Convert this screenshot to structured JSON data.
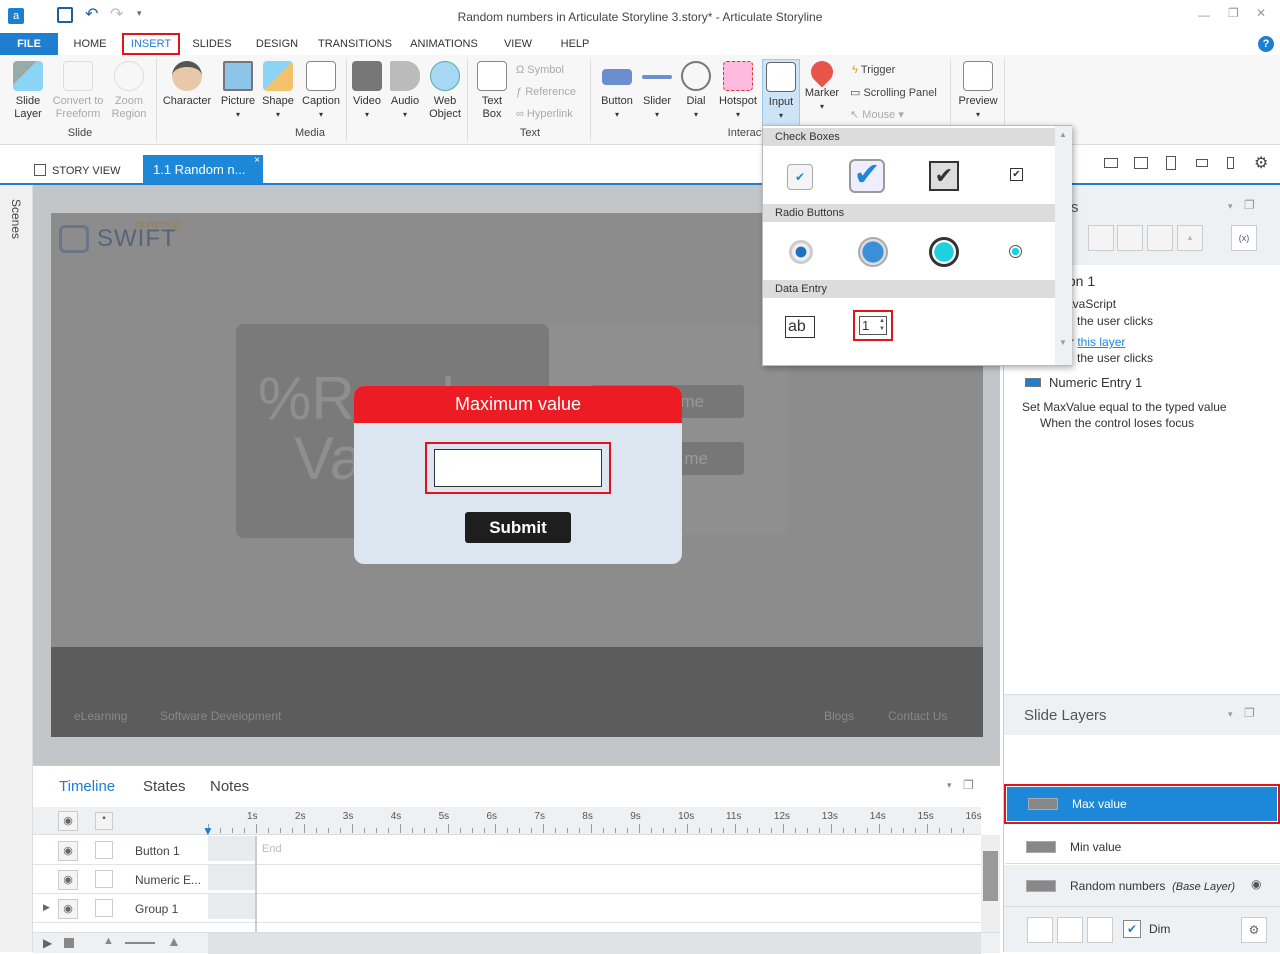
{
  "app": {
    "title": "Random numbers in Articulate Storyline 3.story* -  Articulate Storyline"
  },
  "menu_tabs": [
    "FILE",
    "HOME",
    "INSERT",
    "SLIDES",
    "DESIGN",
    "TRANSITIONS",
    "ANIMATIONS",
    "VIEW",
    "HELP"
  ],
  "active_menu_tab": "INSERT",
  "ribbon": {
    "slide": {
      "label": "Slide",
      "items": [
        "Slide\nLayer",
        "Convert to\nFreeform",
        "Zoom\nRegion"
      ]
    },
    "media": {
      "label": "Media",
      "items": [
        "Character",
        "Picture",
        "Shape",
        "Caption",
        "Video",
        "Audio",
        "Web\nObject"
      ]
    },
    "text": {
      "label": "Text",
      "text_box": "Text\nBox",
      "symbol": "Symbol",
      "reference": "Reference",
      "hyperlink": "Hyperlink"
    },
    "interactive": {
      "label": "Interact",
      "items": [
        "Button",
        "Slider",
        "Dial",
        "Hotspot",
        "Input",
        "Marker"
      ],
      "trigger": "Trigger",
      "scrolling_panel": "Scrolling Panel",
      "mouse": "Mouse"
    },
    "preview": "Preview"
  },
  "doc_tabs": {
    "story_view": "STORY VIEW",
    "slide_tab": "1.1 Random n..."
  },
  "scenes_label": "Scenes",
  "slide": {
    "logo_text": "SWIFT",
    "logo_sub": "eLearning",
    "bg_text1": "%Random",
    "bg_text2": "Va",
    "btn_text1": "me",
    "btn_text2": "me",
    "footer_left": [
      "eLearning",
      "Software Development"
    ],
    "footer_right": [
      "Blogs",
      "Contact Us"
    ],
    "dialog": {
      "title": "Maximum value",
      "input_value": "",
      "submit": "Submit"
    },
    "colors": {
      "dialog_header": "#ed1c24",
      "dialog_body": "#dce6f1"
    }
  },
  "input_dropdown": {
    "sections": [
      "Check Boxes",
      "Radio Buttons",
      "Data Entry"
    ],
    "text_entry_label": "ab",
    "numeric_entry_label": "1"
  },
  "triggers_panel": {
    "title_partial": "rs",
    "button_heading_partial": "ton 1",
    "lines": [
      "avaScript",
      "the user clicks",
      "r",
      "this layer",
      "the user clicks"
    ],
    "numeric_heading": "Numeric Entry 1",
    "numeric_action": "Set MaxValue equal to the typed value",
    "numeric_condition": "When the control loses focus"
  },
  "slide_layers": {
    "title": "Slide Layers",
    "layers": [
      {
        "name": "Max value",
        "selected": true
      },
      {
        "name": "Min value",
        "selected": false
      },
      {
        "name": "Random numbers",
        "tag": "(Base Layer)",
        "selected": false
      }
    ],
    "dim_label": "Dim",
    "dim_checked": true
  },
  "timeline": {
    "tabs": [
      "Timeline",
      "States",
      "Notes"
    ],
    "active_tab": "Timeline",
    "ticks": [
      "1s",
      "2s",
      "3s",
      "4s",
      "5s",
      "6s",
      "7s",
      "8s",
      "9s",
      "10s",
      "11s",
      "12s",
      "13s",
      "14s",
      "15s",
      "16s"
    ],
    "end_label": "End",
    "rows": [
      "Button 1",
      "Numeric E...",
      "Group 1",
      ""
    ]
  },
  "colors": {
    "accent": "#1e7fd0",
    "highlight": "#e0141a",
    "selected_layer": "#1e88d8"
  }
}
